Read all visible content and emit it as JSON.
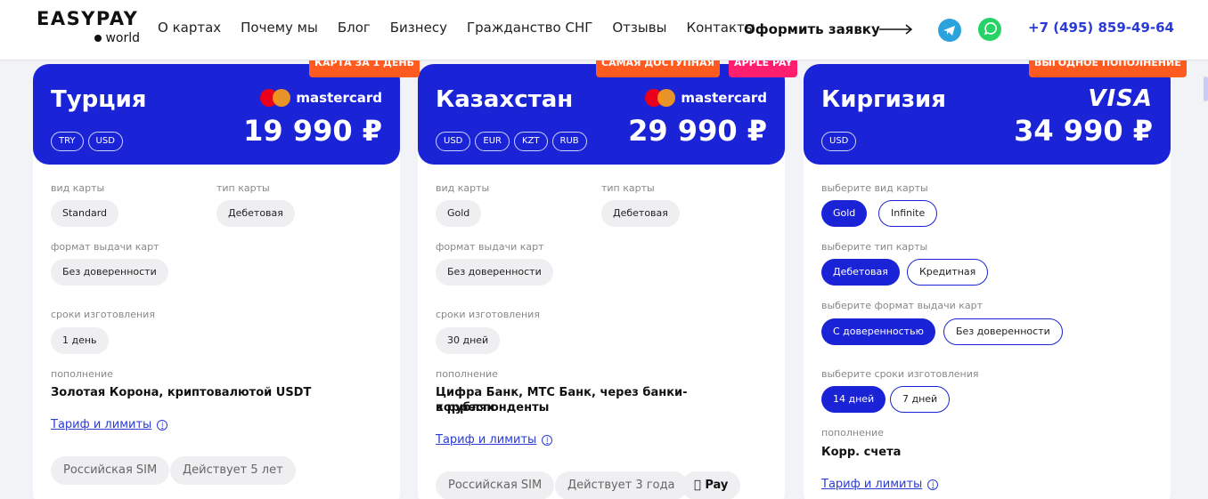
{
  "header": {
    "logo_top": "EASYPAY",
    "logo_bottom": "world",
    "nav": [
      "О картах",
      "Почему мы",
      "Блог",
      "Бизнесу",
      "Гражданство СНГ",
      "Отзывы",
      "Контакты"
    ],
    "apply_label": "Оформить заявку",
    "phone": "+7 (495) 859-49-64",
    "icons": [
      "telegram-icon",
      "whatsapp-icon",
      "arrow-right-icon"
    ]
  },
  "cards": [
    {
      "country": "Турция",
      "brand": "mastercard",
      "price": "19 990 ₽",
      "currencies": [
        "TRY",
        "USD"
      ],
      "badges": [
        "КАРТА ЗА 1 ДЕНЬ"
      ],
      "card_kind_label": "вид карты",
      "card_kind": "Standard",
      "card_type_label": "тип карты",
      "card_type": "Дебетовая",
      "format_label": "формат выдачи карт",
      "format": "Без доверенности",
      "term_label": "сроки изготовления",
      "term": "1 день",
      "topup_label": "пополнение",
      "topup": "Золотая Корона, криптовалютой USDT",
      "tariff_link": "Тариф и лимиты",
      "tags": [
        "Российская SIM",
        "Действует 5 лет"
      ]
    },
    {
      "country": "Казахстан",
      "brand": "mastercard",
      "price": "29 990 ₽",
      "currencies": [
        "USD",
        "EUR",
        "KZT",
        "RUB"
      ],
      "badges": [
        "САМАЯ ДОСТУПНАЯ",
        "APPLE PAY"
      ],
      "card_kind_label": "вид карты",
      "card_kind": "Gold",
      "card_type_label": "тип карты",
      "card_type": "Дебетовая",
      "format_label": "формат выдачи карт",
      "format": "Без доверенности",
      "term_label": "сроки изготовления",
      "term": "30 дней",
      "topup_label": "пополнение",
      "topup_line1": "Цифра Банк, МТС Банк, через банки-корреспонденты",
      "topup_line2": "в рублях",
      "tariff_link": "Тариф и лимиты",
      "tags": [
        "Российская SIM",
        "Действует 3 года"
      ],
      "apple_pay": "Pay"
    },
    {
      "country": "Киргизия",
      "brand": "VISA",
      "price": "34 990 ₽",
      "currencies": [
        "USD"
      ],
      "badges": [
        "ВЫГОДНОЕ ПОПОЛНЕНИЕ"
      ],
      "card_kind_label": "выберите вид карты",
      "card_kind_options": [
        "Gold",
        "Infinite"
      ],
      "card_type_label": "выберите тип карты",
      "card_type_options": [
        "Дебетовая",
        "Кредитная"
      ],
      "format_label": "выберите формат выдачи карт",
      "format_options": [
        "С доверенностью",
        "Без доверенности"
      ],
      "term_label": "выберите сроки изготовления",
      "term_options": [
        "14 дней",
        "7 дней"
      ],
      "topup_label": "пополнение",
      "topup": "Корр. счета",
      "tariff_link": "Тариф и лимиты"
    }
  ],
  "colors": {
    "brand_blue": "#1b23d6",
    "badge_orange": "#ff5a1f",
    "badge_pink": "#ff1f6e",
    "link_blue": "#2a3bd6"
  }
}
